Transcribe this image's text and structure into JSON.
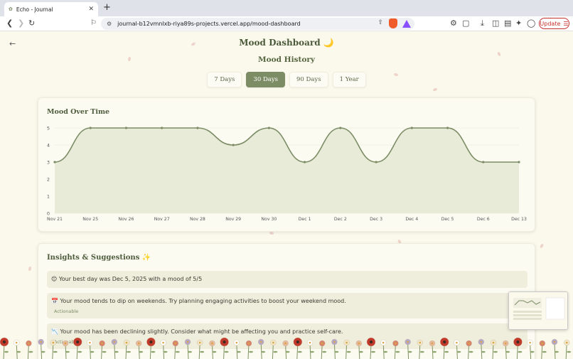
{
  "browser": {
    "tab_title": "Echo - Journal",
    "url": "journal-b12vmnlxb-riya89s-projects.vercel.app/mood-dashboard",
    "update_label": "Update"
  },
  "page": {
    "title": "Mood Dashboard 🌙",
    "subtitle": "Mood History",
    "ranges": [
      "7 Days",
      "30 Days",
      "90 Days",
      "1 Year"
    ],
    "active_range": "30 Days"
  },
  "chart_data": {
    "type": "area",
    "title": "Mood Over Time",
    "categories": [
      "Nov 21",
      "Nov 25",
      "Nov 26",
      "Nov 27",
      "Nov 28",
      "Nov 29",
      "Nov 30",
      "Dec 1",
      "Dec 2",
      "Dec 3",
      "Dec 4",
      "Dec 5",
      "Dec 6",
      "Dec 13"
    ],
    "values": [
      3,
      5,
      5,
      5,
      5,
      4,
      5,
      3,
      5,
      3,
      5,
      5,
      3,
      3
    ],
    "ylim": [
      0,
      5
    ],
    "yticks": [
      "0",
      "1",
      "2",
      "3",
      "4",
      "5"
    ],
    "grid": true,
    "line_color": "#7c8d66",
    "fill_color": "#e9ebd9"
  },
  "insights": {
    "title": "Insights & Suggestions ✨",
    "items": [
      {
        "icon": "😊",
        "text": "Your best day was Dec 5, 2025 with a mood of 5/5",
        "tag": ""
      },
      {
        "icon": "📅",
        "text": "Your mood tends to dip on weekends. Try planning engaging activities to boost your weekend mood.",
        "tag": "Actionable"
      },
      {
        "icon": "📉",
        "text": "Your mood has been declining slightly. Consider what might be affecting you and practice self-care.",
        "tag": "Actionable"
      }
    ]
  },
  "colors": {
    "accent": "#7c8d66",
    "background": "#fbf9ec"
  }
}
